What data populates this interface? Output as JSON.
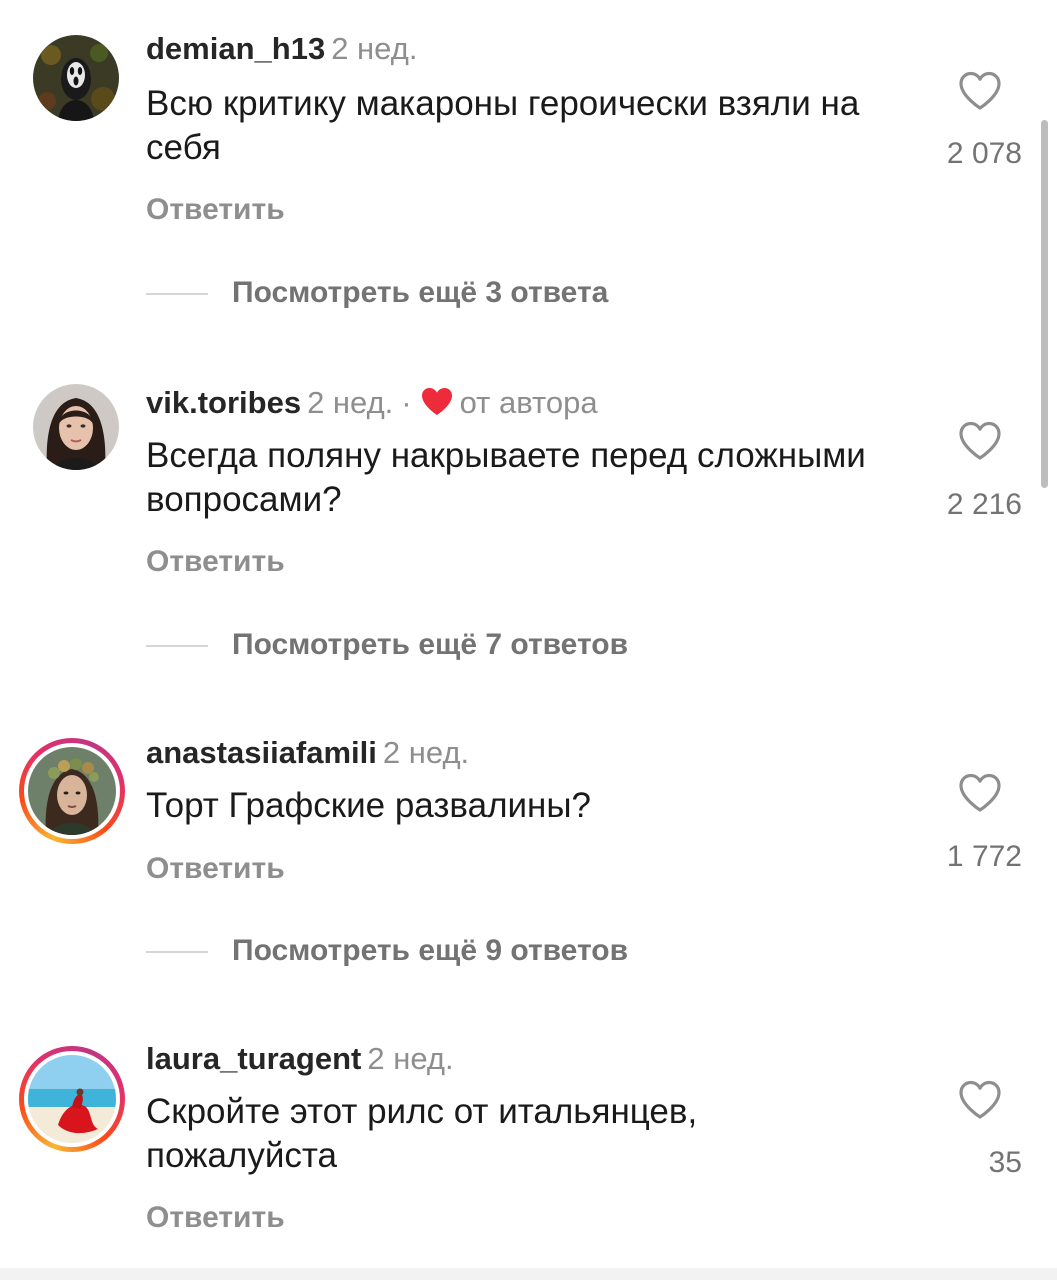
{
  "comments": [
    {
      "username": "demian_h13",
      "time": "2 нед.",
      "text": "Всю критику макароны героически взяли на себя",
      "reply_label": "Ответить",
      "likes": "2 078",
      "more_replies": "Посмотреть ещё 3 ответа",
      "avatar": "ghostface-mask-avatar"
    },
    {
      "username": "vik.toribes",
      "time": "2 нед.",
      "separator": "·",
      "author_badge": "от автора",
      "text": "Всегда поляну накрываете перед сложными вопросами?",
      "reply_label": "Ответить",
      "likes": "2 216",
      "more_replies": "Посмотреть ещё 7 ответов",
      "avatar": "woman-portrait-avatar"
    },
    {
      "username": "anastasiiafamili",
      "time": "2 нед.",
      "text": "Торт Графские развалины?",
      "reply_label": "Ответить",
      "likes": "1 772",
      "more_replies": "Посмотреть ещё 9 ответов",
      "avatar": "flower-crown-portrait-avatar"
    },
    {
      "username": "laura_turagent",
      "time": "2 нед.",
      "text": "Скройте этот рилс от итальянцев, пожалуйста",
      "reply_label": "Ответить",
      "likes": "35",
      "avatar": "beach-red-dress-avatar"
    }
  ],
  "colors": {
    "author_heart": "#ed2b3a",
    "story_ring": [
      "#f7b733",
      "#fc4a1a",
      "#e1306c",
      "#c13584"
    ],
    "muted_text": "#8e8e8e"
  }
}
